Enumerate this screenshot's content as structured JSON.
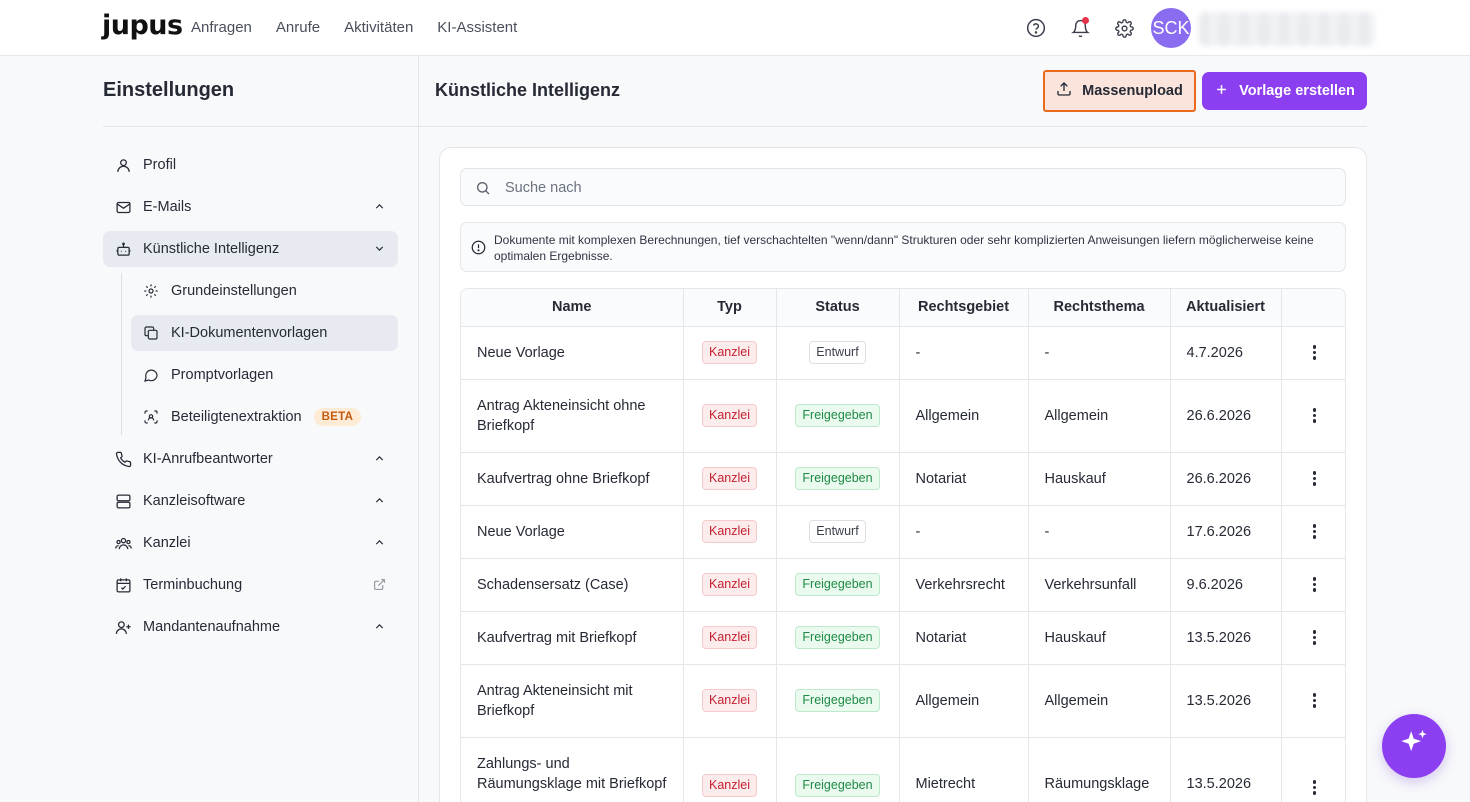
{
  "header": {
    "logo": "jupus",
    "nav": [
      "Anfragen",
      "Anrufe",
      "Aktivitäten",
      "KI-Assistent"
    ],
    "avatar_initials": "SCK"
  },
  "sidebar": {
    "title": "Einstellungen",
    "items": [
      {
        "label": "Profil",
        "icon": "user-icon"
      },
      {
        "label": "E-Mails",
        "icon": "mail-icon"
      },
      {
        "label": "Künstliche Intelligenz",
        "icon": "bot-icon"
      },
      {
        "label": "KI-Anrufbeantworter",
        "icon": "phone-icon"
      },
      {
        "label": "Kanzleisoftware",
        "icon": "server-icon"
      },
      {
        "label": "Kanzlei",
        "icon": "team-icon"
      },
      {
        "label": "Terminbuchung",
        "icon": "calendar-check-icon"
      },
      {
        "label": "Mandantenaufnahme",
        "icon": "user-plus-icon"
      }
    ],
    "sub_items": [
      {
        "label": "Grundeinstellungen",
        "icon": "gear-icon"
      },
      {
        "label": "KI-Dokumentenvorlagen",
        "icon": "copy-icon"
      },
      {
        "label": "Promptvorlagen",
        "icon": "chat-icon"
      },
      {
        "label": "Beteiligtenextraktion",
        "icon": "scan-icon",
        "badge": "BETA"
      }
    ]
  },
  "main": {
    "title": "Künstliche Intelligenz",
    "upload_label": "Massenupload",
    "create_label": "Vorlage erstellen",
    "search_placeholder": "Suche nach",
    "info_text": "Dokumente mit komplexen Berechnungen, tief verschachtelten \"wenn/dann\" Strukturen oder sehr komplizierten Anweisungen liefern möglicherweise keine optimalen Ergebnisse."
  },
  "table": {
    "columns": [
      "Name",
      "Typ",
      "Status",
      "Rechtsgebiet",
      "Rechtsthema",
      "Aktualisiert"
    ],
    "rows": [
      {
        "name": "Neue Vorlage",
        "typ": "Kanzlei",
        "status": "Entwurf",
        "gebiet": "-",
        "thema": "-",
        "date": "4.7.2026"
      },
      {
        "name": "Antrag Akteneinsicht ohne Briefkopf",
        "typ": "Kanzlei",
        "status": "Freigegeben",
        "gebiet": "Allgemein",
        "thema": "Allgemein",
        "date": "26.6.2026"
      },
      {
        "name": "Kaufvertrag ohne Briefkopf",
        "typ": "Kanzlei",
        "status": "Freigegeben",
        "gebiet": "Notariat",
        "thema": "Hauskauf",
        "date": "26.6.2026"
      },
      {
        "name": "Neue Vorlage",
        "typ": "Kanzlei",
        "status": "Entwurf",
        "gebiet": "-",
        "thema": "-",
        "date": "17.6.2026"
      },
      {
        "name": "Schadensersatz (Case)",
        "typ": "Kanzlei",
        "status": "Freigegeben",
        "gebiet": "Verkehrsrecht",
        "thema": "Verkehrsunfall",
        "date": "9.6.2026"
      },
      {
        "name": "Kaufvertrag mit Briefkopf",
        "typ": "Kanzlei",
        "status": "Freigegeben",
        "gebiet": "Notariat",
        "thema": "Hauskauf",
        "date": "13.5.2026"
      },
      {
        "name": "Antrag Akteneinsicht mit Briefkopf",
        "typ": "Kanzlei",
        "status": "Freigegeben",
        "gebiet": "Allgemein",
        "thema": "Allgemein",
        "date": "13.5.2026"
      },
      {
        "name": "Zahlungs- und Räumungsklage mit Briefkopf",
        "typ": "Kanzlei",
        "status": "Freigegeben",
        "gebiet": "Mietrecht",
        "thema": "Räumungsklage",
        "date": "13.5.2026"
      }
    ]
  },
  "colors": {
    "accent": "#8b3ff0",
    "upload_border": "#e86a1a"
  }
}
